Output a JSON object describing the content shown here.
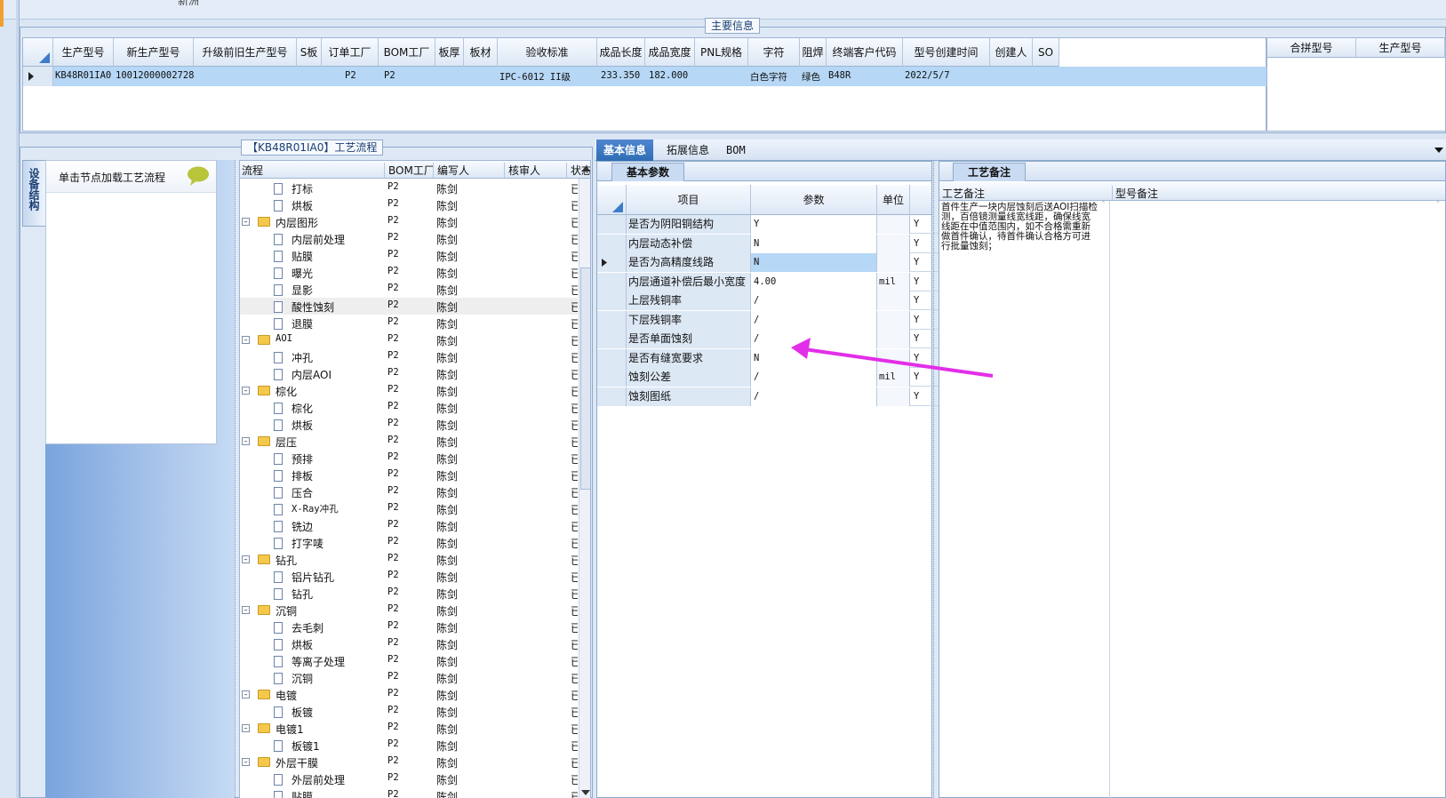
{
  "top": {
    "cut_text": "新洲"
  },
  "main_info": {
    "legend": "主要信息",
    "columns": [
      "生产型号",
      "新生产型号",
      "升级前旧生产型号",
      "S板",
      "订单工厂",
      "BOM工厂",
      "板厚",
      "板材",
      "验收标准",
      "成品长度",
      "成品宽度",
      "PNL规格",
      "字符",
      "阻焊",
      "终端客户代码",
      "型号创建时间",
      "创建人",
      "SO"
    ],
    "row": {
      "prod_no": "KB48R01IA0",
      "new_prod_no": "10012000002728",
      "old_no": "",
      "s": "",
      "order_factory": "P2",
      "bom_factory": "P2",
      "thickness": "",
      "material": "",
      "standard": "IPC-6012 II级",
      "length": "233.350",
      "width": "182.000",
      "pnl": "",
      "char": "白色字符",
      "mask": "绿色",
      "customer": "B48R",
      "created": "2022/5/7",
      "creator": "",
      "so": ""
    },
    "right_columns": [
      "合拼型号",
      "生产型号"
    ]
  },
  "process": {
    "legend": "【KB48R01IA0】工艺流程",
    "side_tab": "设备结构",
    "hint": "单击节点加载工艺流程",
    "columns": [
      "流程",
      "BOM工厂",
      "编写人",
      "核审人",
      "状态"
    ],
    "rows": [
      {
        "name": "打标",
        "type": "doc",
        "level": 2,
        "bom": "P2",
        "writer": "陈剑",
        "status": "已编写"
      },
      {
        "name": "烘板",
        "type": "doc",
        "level": 2,
        "bom": "P2",
        "writer": "陈剑",
        "status": "已编写"
      },
      {
        "name": "内层图形",
        "type": "folder",
        "level": 1,
        "bom": "P2",
        "writer": "陈剑",
        "status": "已编写"
      },
      {
        "name": "内层前处理",
        "type": "doc",
        "level": 2,
        "bom": "P2",
        "writer": "陈剑",
        "status": "已编写"
      },
      {
        "name": "贴膜",
        "type": "doc",
        "level": 2,
        "bom": "P2",
        "writer": "陈剑",
        "status": "已编写"
      },
      {
        "name": "曝光",
        "type": "doc",
        "level": 2,
        "bom": "P2",
        "writer": "陈剑",
        "status": "已编写"
      },
      {
        "name": "显影",
        "type": "doc",
        "level": 2,
        "bom": "P2",
        "writer": "陈剑",
        "status": "已编写"
      },
      {
        "name": "酸性蚀刻",
        "type": "doc",
        "level": 2,
        "bom": "P2",
        "writer": "陈剑",
        "status": "已编写",
        "selected": true
      },
      {
        "name": "退膜",
        "type": "doc",
        "level": 2,
        "bom": "P2",
        "writer": "陈剑",
        "status": "已编写"
      },
      {
        "name": "AOI",
        "type": "folder",
        "level": 1,
        "bom": "P2",
        "writer": "陈剑",
        "status": "已编写"
      },
      {
        "name": "冲孔",
        "type": "doc",
        "level": 2,
        "bom": "P2",
        "writer": "陈剑",
        "status": "已编写"
      },
      {
        "name": "内层AOI",
        "type": "doc",
        "level": 2,
        "bom": "P2",
        "writer": "陈剑",
        "status": "已编写"
      },
      {
        "name": "棕化",
        "type": "folder",
        "level": 1,
        "bom": "P2",
        "writer": "陈剑",
        "status": "已编写"
      },
      {
        "name": "棕化",
        "type": "doc",
        "level": 2,
        "bom": "P2",
        "writer": "陈剑",
        "status": "已编写"
      },
      {
        "name": "烘板",
        "type": "doc",
        "level": 2,
        "bom": "P2",
        "writer": "陈剑",
        "status": "已编写"
      },
      {
        "name": "层压",
        "type": "folder",
        "level": 1,
        "bom": "P2",
        "writer": "陈剑",
        "status": "已编写"
      },
      {
        "name": "预排",
        "type": "doc",
        "level": 2,
        "bom": "P2",
        "writer": "陈剑",
        "status": "已编写"
      },
      {
        "name": "排板",
        "type": "doc",
        "level": 2,
        "bom": "P2",
        "writer": "陈剑",
        "status": "已编写"
      },
      {
        "name": "压合",
        "type": "doc",
        "level": 2,
        "bom": "P2",
        "writer": "陈剑",
        "status": "已编写"
      },
      {
        "name": "X-Ray冲孔",
        "type": "doc",
        "level": 2,
        "bom": "P2",
        "writer": "陈剑",
        "status": "已编写"
      },
      {
        "name": "铣边",
        "type": "doc",
        "level": 2,
        "bom": "P2",
        "writer": "陈剑",
        "status": "已编写"
      },
      {
        "name": "打字唛",
        "type": "doc",
        "level": 2,
        "bom": "P2",
        "writer": "陈剑",
        "status": "已编写"
      },
      {
        "name": "钻孔",
        "type": "folder",
        "level": 1,
        "bom": "P2",
        "writer": "陈剑",
        "status": "已编写"
      },
      {
        "name": "铝片钻孔",
        "type": "doc",
        "level": 2,
        "bom": "P2",
        "writer": "陈剑",
        "status": "已编写"
      },
      {
        "name": "钻孔",
        "type": "doc",
        "level": 2,
        "bom": "P2",
        "writer": "陈剑",
        "status": "已编写"
      },
      {
        "name": "沉铜",
        "type": "folder",
        "level": 1,
        "bom": "P2",
        "writer": "陈剑",
        "status": "已编写"
      },
      {
        "name": "去毛刺",
        "type": "doc",
        "level": 2,
        "bom": "P2",
        "writer": "陈剑",
        "status": "已编写"
      },
      {
        "name": "烘板",
        "type": "doc",
        "level": 2,
        "bom": "P2",
        "writer": "陈剑",
        "status": "已编写"
      },
      {
        "name": "等离子处理",
        "type": "doc",
        "level": 2,
        "bom": "P2",
        "writer": "陈剑",
        "status": "已编写"
      },
      {
        "name": "沉铜",
        "type": "doc",
        "level": 2,
        "bom": "P2",
        "writer": "陈剑",
        "status": "已编写"
      },
      {
        "name": "电镀",
        "type": "folder",
        "level": 1,
        "bom": "P2",
        "writer": "陈剑",
        "status": "已编写"
      },
      {
        "name": "板镀",
        "type": "doc",
        "level": 2,
        "bom": "P2",
        "writer": "陈剑",
        "status": "已编写"
      },
      {
        "name": "电镀1",
        "type": "folder",
        "level": 1,
        "bom": "P2",
        "writer": "陈剑",
        "status": "已编写"
      },
      {
        "name": "板镀1",
        "type": "doc",
        "level": 2,
        "bom": "P2",
        "writer": "陈剑",
        "status": "已编写"
      },
      {
        "name": "外层干膜",
        "type": "folder",
        "level": 1,
        "bom": "P2",
        "writer": "陈剑",
        "status": "已编写"
      },
      {
        "name": "外层前处理",
        "type": "doc",
        "level": 2,
        "bom": "P2",
        "writer": "陈剑",
        "status": "已编写"
      },
      {
        "name": "贴膜",
        "type": "doc",
        "level": 2,
        "bom": "P2",
        "writer": "陈剑",
        "status": "已编写"
      }
    ]
  },
  "detail": {
    "tabs": [
      "基本信息",
      "拓展信息",
      "BOM"
    ],
    "sub_tab": "基本参数",
    "param_columns": [
      "项目",
      "参数",
      "单位"
    ],
    "params": [
      {
        "item": "是否为阴阳铜结构",
        "value": "Y",
        "unit": "",
        "flag": "Y"
      },
      {
        "item": "内层动态补偿",
        "value": "N",
        "unit": "",
        "flag": "Y"
      },
      {
        "item": "是否为高精度线路",
        "value": "N",
        "unit": "",
        "flag": "Y",
        "current": true
      },
      {
        "item": "内层通道补偿后最小宽度",
        "value": "4.00",
        "unit": "mil",
        "flag": "Y"
      },
      {
        "item": "上层残铜率",
        "value": "/",
        "unit": "",
        "flag": "Y"
      },
      {
        "item": "下层残铜率",
        "value": "/",
        "unit": "",
        "flag": "Y"
      },
      {
        "item": "是否单面蚀刻",
        "value": "/",
        "unit": "",
        "flag": "Y"
      },
      {
        "item": "是否有缝宽要求",
        "value": "N",
        "unit": "",
        "flag": "Y"
      },
      {
        "item": "蚀刻公差",
        "value": "/",
        "unit": "mil",
        "flag": "Y"
      },
      {
        "item": "蚀刻图纸",
        "value": "/",
        "unit": "",
        "flag": "Y"
      }
    ],
    "remark_tab": "工艺备注",
    "remark_columns": [
      "工艺备注",
      "型号备注"
    ],
    "remark_text": "首件生产一块内层蚀刻后送AOI扫描检测，百倍镜测量线宽线距，确保线宽线距在中值范围内，如不合格需重新做首件确认，待首件确认合格方可进行批量蚀刻；"
  },
  "colors": {
    "annotation_arrow": "#e22ee8",
    "selection": "#b6d7f5",
    "accent": "#2f6db5"
  }
}
